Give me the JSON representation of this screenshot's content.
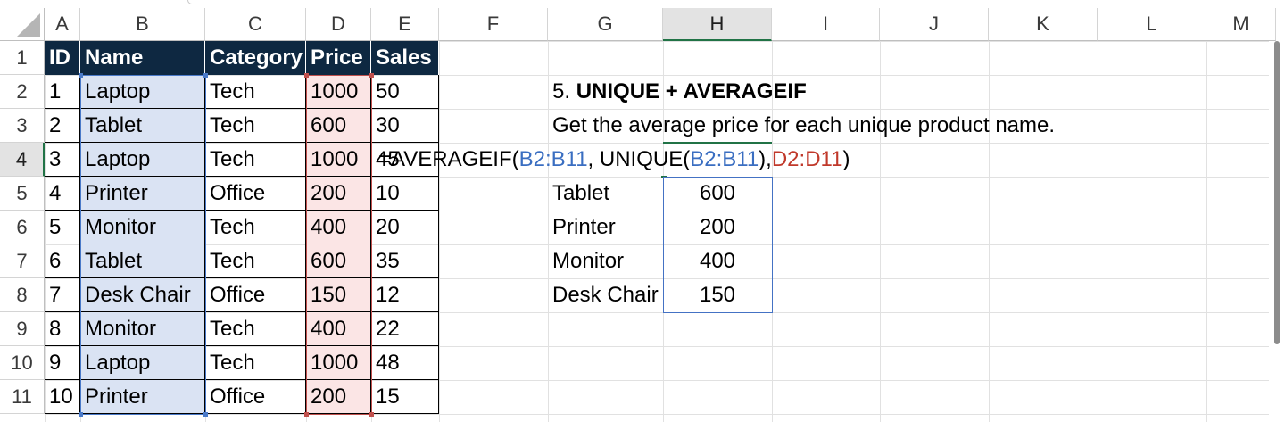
{
  "columns": [
    "A",
    "B",
    "C",
    "D",
    "E",
    "F",
    "G",
    "H",
    "I",
    "J",
    "K",
    "L",
    "M"
  ],
  "rows": [
    "1",
    "2",
    "3",
    "4",
    "5",
    "6",
    "7",
    "8",
    "9",
    "10",
    "11"
  ],
  "selected_column": "H",
  "selected_row": "4",
  "table": {
    "headers": [
      "ID",
      "Name",
      "Category",
      "Price",
      "Sales"
    ],
    "rows": [
      [
        "1",
        "Laptop",
        "Tech",
        "1000",
        "50"
      ],
      [
        "2",
        "Tablet",
        "Tech",
        "600",
        "30"
      ],
      [
        "3",
        "Laptop",
        "Tech",
        "1000",
        "45"
      ],
      [
        "4",
        "Printer",
        "Office",
        "200",
        "10"
      ],
      [
        "5",
        "Monitor",
        "Tech",
        "400",
        "20"
      ],
      [
        "6",
        "Tablet",
        "Tech",
        "600",
        "35"
      ],
      [
        "7",
        "Desk Chair",
        "Office",
        "150",
        "12"
      ],
      [
        "8",
        "Monitor",
        "Tech",
        "400",
        "22"
      ],
      [
        "9",
        "Laptop",
        "Tech",
        "1000",
        "48"
      ],
      [
        "10",
        "Printer",
        "Office",
        "200",
        "15"
      ]
    ]
  },
  "section_title": {
    "number": "5.",
    "bold": "UNIQUE + AVERAGEIF"
  },
  "description": "Get the average price for each unique product name.",
  "formula": {
    "p1": "=AVERAGEIF(",
    "ref1": "B2:B11",
    "p2": ", UNIQUE(",
    "ref2": "B2:B11",
    "p3": "), ",
    "ref3": "D2:D11",
    "p4": ")"
  },
  "results": [
    {
      "name": "Tablet",
      "value": "600"
    },
    {
      "name": "Printer",
      "value": "200"
    },
    {
      "name": "Monitor",
      "value": "400"
    },
    {
      "name": "Desk Chair",
      "value": "150"
    }
  ],
  "colors": {
    "header_fill": "#0e2841",
    "name_highlight": "#dae3f3",
    "price_highlight": "#fbe5e5",
    "ref_blue": "#3a6ec1",
    "ref_red": "#c0392b",
    "selection_green": "#217346"
  },
  "icons": [
    "select-all-triangle-icon"
  ]
}
